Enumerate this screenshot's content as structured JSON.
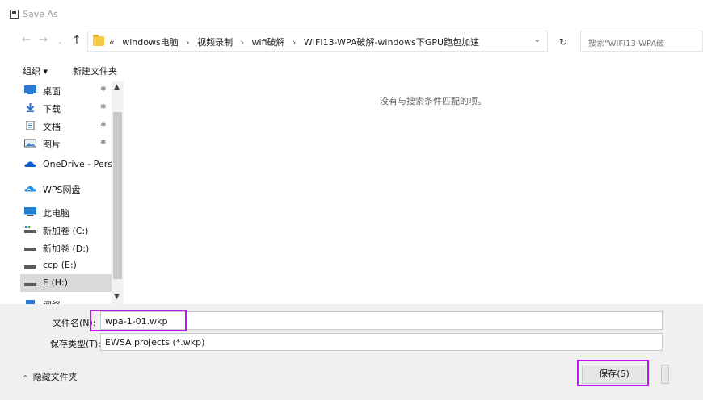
{
  "window": {
    "title": "Save As"
  },
  "nav": {
    "back": "←",
    "forward": "→",
    "recent": "⌄",
    "up": "↑",
    "breadcrumbs": [
      "«",
      "windows电脑",
      "›",
      "视频录制",
      "›",
      "wifi破解",
      "›",
      "WIFI13-WPA破解-windows下GPU跑包加速"
    ],
    "dropdown": "⌄",
    "refresh": "↻",
    "search_placeholder": "搜索\"WIFI13-WPA破"
  },
  "toolbar": {
    "organize": "组织 ▾",
    "new_folder": "新建文件夹"
  },
  "sidebar": {
    "items": [
      {
        "label": "桌面",
        "icon": "desktop-icon",
        "pinned": "📌"
      },
      {
        "label": "下载",
        "icon": "download-icon",
        "pinned": "📌"
      },
      {
        "label": "文档",
        "icon": "document-icon",
        "pinned": "📌"
      },
      {
        "label": "图片",
        "icon": "picture-icon",
        "pinned": "📌"
      },
      {
        "label": "OneDrive - Pers",
        "icon": "onedrive-icon"
      },
      {
        "label": "WPS网盘",
        "icon": "wps-cloud-icon"
      },
      {
        "label": "此电脑",
        "icon": "computer-icon"
      },
      {
        "label": "新加卷 (C:)",
        "icon": "drive-icon"
      },
      {
        "label": "新加卷 (D:)",
        "icon": "drive-icon"
      },
      {
        "label": "ccp (E:)",
        "icon": "drive-icon"
      },
      {
        "label": "E (H:)",
        "icon": "drive-icon"
      },
      {
        "label": "网络",
        "icon": "network-icon"
      }
    ],
    "scroll_up": "▲",
    "scroll_down": "▼"
  },
  "main": {
    "empty_message": "没有与搜索条件匹配的项。"
  },
  "bottom": {
    "filename_label": "文件名(N):",
    "filename_value": "wpa-1-01.wkp",
    "filetype_label": "保存类型(T):",
    "filetype_value": "EWSA projects (*.wkp)",
    "hide_folders": "隐藏文件夹",
    "hide_caret": "^",
    "save_button": "保存(S)"
  },
  "colors": {
    "highlight": "#b81aee",
    "folder": "#f7c948",
    "drive": "#5b5b5b"
  }
}
